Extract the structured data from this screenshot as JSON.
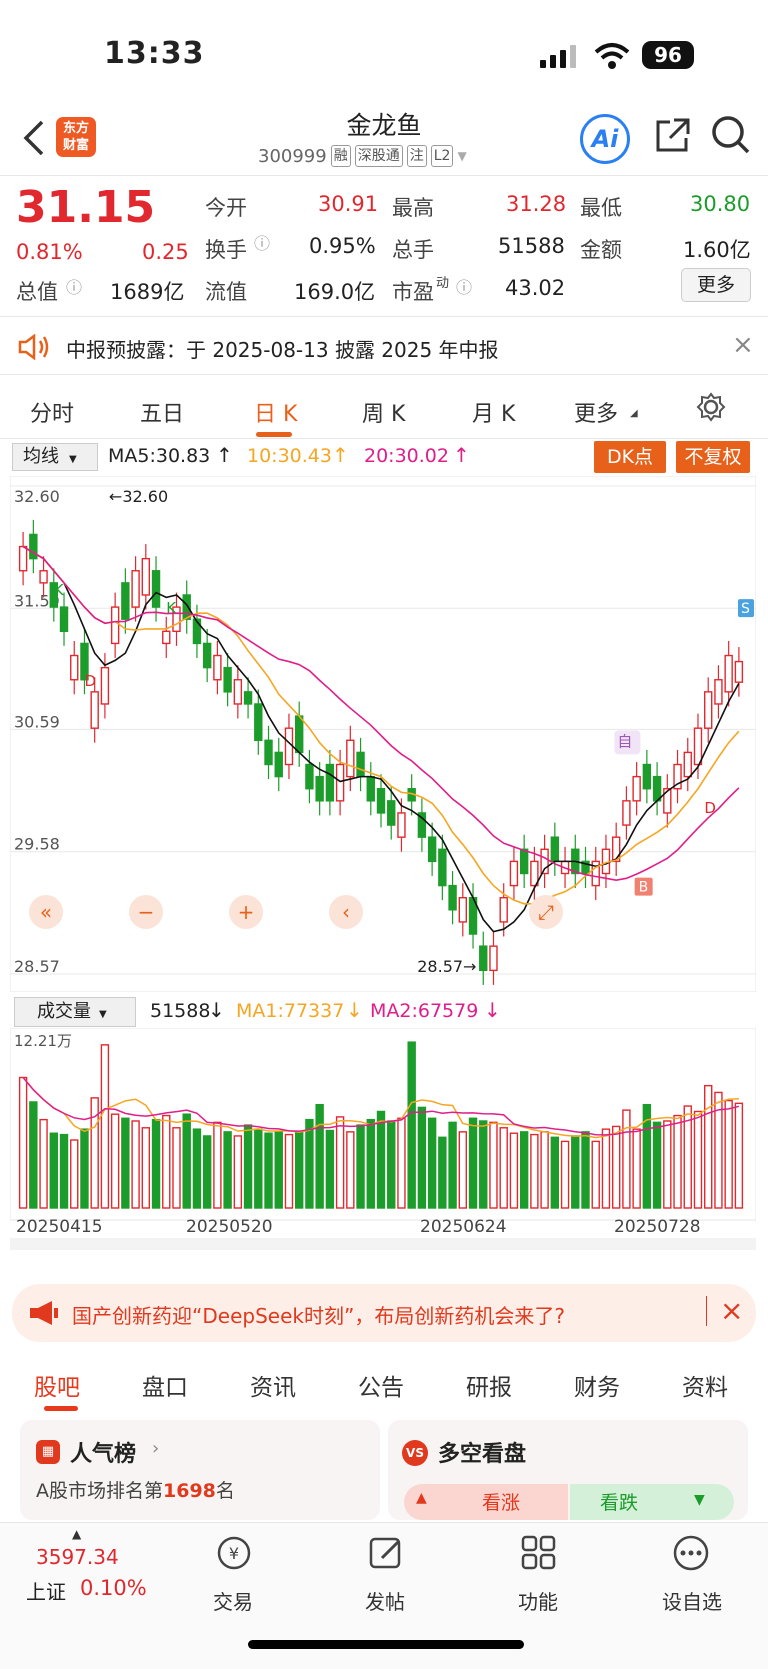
{
  "status": {
    "time": "13:33",
    "battery": "96"
  },
  "header": {
    "title": "金龙鱼",
    "code": "300999",
    "tags": [
      "融",
      "深股通",
      "注",
      "L2"
    ],
    "logo": [
      "东方",
      "财富"
    ],
    "ai_label": "Ai"
  },
  "quote": {
    "price": "31.15",
    "change_pct": "0.81%",
    "change_amt": "0.25",
    "open_label": "今开",
    "open": "30.91",
    "high_label": "最高",
    "high": "31.28",
    "low_label": "最低",
    "low": "30.80",
    "turnover_label": "换手",
    "turnover": "0.95%",
    "volume_label": "总手",
    "volume": "51588",
    "amount_label": "金额",
    "amount": "1.60亿",
    "mktcap_label": "总值",
    "mktcap": "1689亿",
    "float_label": "流值",
    "float": "169.0亿",
    "pe_label": "市盈",
    "pe_sup": "动",
    "pe": "43.02",
    "more_label": "更多"
  },
  "notice": {
    "text": "中报预披露：于 2025-08-13 披露 2025 年中报"
  },
  "chart_tabs": [
    {
      "label": "分时"
    },
    {
      "label": "五日"
    },
    {
      "label": "日 K"
    },
    {
      "label": "周 K"
    },
    {
      "label": "月 K"
    },
    {
      "label": "更多"
    }
  ],
  "ma": {
    "selector": "均线",
    "ma5": "MA5:30.83",
    "ma10": "10:30.43",
    "ma20": "20:30.02",
    "dk_btn": "DK点",
    "fq_btn": "不复权"
  },
  "volume_panel": {
    "selector": "成交量",
    "value": "51588",
    "ma1": "MA1:77337",
    "ma2": "MA2:67579"
  },
  "colors": {
    "up": "#e0282e",
    "down": "#1c9c2a",
    "ma5": "#111111",
    "ma10": "#f5a623",
    "ma20": "#e01e8a",
    "accent": "#e8611a"
  },
  "chart_data": {
    "type": "candlestick",
    "y_ticks": [
      "32.60",
      "31.59",
      "30.59",
      "29.58",
      "28.57"
    ],
    "ylim": [
      28.57,
      32.6
    ],
    "max_label": "32.60",
    "min_label": "28.57",
    "x_labels": [
      "20250415",
      "20250520",
      "20250624",
      "20250728"
    ],
    "vol_max_label": "12.21万",
    "markers": {
      "k": "K",
      "d": "D",
      "s": "S",
      "b": "B",
      "zi": "自"
    },
    "closes": [
      32.1,
      32.0,
      31.9,
      31.6,
      31.4,
      31.2,
      31.0,
      30.9,
      31.1,
      31.6,
      31.5,
      31.9,
      32.0,
      31.6,
      31.4,
      31.6,
      31.5,
      31.3,
      31.1,
      31.2,
      30.9,
      31.0,
      30.8,
      30.5,
      30.3,
      30.2,
      30.6,
      30.4,
      30.1,
      30.0,
      30.0,
      30.3,
      30.5,
      30.2,
      30.0,
      29.9,
      29.8,
      29.9,
      30.0,
      29.7,
      29.5,
      29.3,
      29.1,
      29.2,
      28.9,
      28.6,
      28.8,
      29.2,
      29.5,
      29.4,
      29.5,
      29.6,
      29.5,
      29.5,
      29.4,
      29.4,
      29.5,
      29.6,
      29.7,
      30.0,
      30.2,
      30.1,
      30.0,
      30.1,
      30.3,
      30.4,
      30.6,
      30.9,
      31.0,
      31.2,
      31.15
    ],
    "opens": [
      31.9,
      32.2,
      31.8,
      31.8,
      31.6,
      31.0,
      31.3,
      30.6,
      30.8,
      31.3,
      31.8,
      31.6,
      31.7,
      31.9,
      31.3,
      31.4,
      31.7,
      31.5,
      31.3,
      31.0,
      31.1,
      30.8,
      30.9,
      30.8,
      30.5,
      30.4,
      30.3,
      30.7,
      30.3,
      30.2,
      30.3,
      30.0,
      30.2,
      30.4,
      30.2,
      30.1,
      30.0,
      29.7,
      30.1,
      29.9,
      29.7,
      29.6,
      29.3,
      29.0,
      29.2,
      28.8,
      28.6,
      29.0,
      29.3,
      29.6,
      29.3,
      29.4,
      29.7,
      29.4,
      29.6,
      29.5,
      29.3,
      29.4,
      29.5,
      29.8,
      30.0,
      30.3,
      30.2,
      29.9,
      30.1,
      30.2,
      30.3,
      30.6,
      30.8,
      30.9,
      30.98
    ],
    "volumes": [
      9.6,
      7.8,
      6.5,
      5.5,
      5.4,
      5.0,
      5.8,
      8.1,
      12.0,
      6.9,
      6.6,
      6.4,
      5.9,
      6.5,
      6.8,
      5.9,
      6.9,
      5.8,
      5.3,
      6.3,
      5.6,
      5.3,
      6.1,
      5.8,
      5.5,
      5.6,
      5.4,
      5.6,
      6.5,
      7.6,
      5.7,
      6.7,
      5.6,
      6.1,
      6.5,
      7.1,
      6.4,
      6.6,
      12.2,
      7.4,
      6.6,
      5.2,
      6.3,
      5.6,
      6.6,
      6.4,
      6.3,
      5.9,
      5.5,
      5.6,
      5.4,
      5.6,
      5.2,
      4.9,
      5.3,
      5.6,
      4.9,
      5.8,
      6.0,
      7.2,
      5.8,
      7.6,
      6.3,
      6.4,
      6.8,
      7.5,
      7.1,
      9.0,
      8.5,
      7.9,
      7.7
    ],
    "ma5": "black line, ends 30.83",
    "ma10_last": 30.43,
    "ma20_last": 30.02
  },
  "promo_banner": {
    "text": "国产创新药迎“DeepSeek时刻”，布局创新药机会来了?"
  },
  "bottom_tabs": [
    {
      "label": "股吧"
    },
    {
      "label": "盘口"
    },
    {
      "label": "资讯"
    },
    {
      "label": "公告"
    },
    {
      "label": "研报"
    },
    {
      "label": "财务"
    },
    {
      "label": "资料"
    }
  ],
  "cards": {
    "popularity": {
      "title": "人气榜",
      "rank_prefix": "A股市场排名第",
      "rank": "1698",
      "rank_suffix": "名"
    },
    "bullbear": {
      "title": "多空看盘",
      "bull": "看涨",
      "bear": "看跌"
    }
  },
  "nav": {
    "index_value": "3597.34",
    "index_name": "上证",
    "index_change": "0.10%",
    "items": [
      {
        "label": "交易"
      },
      {
        "label": "发帖"
      },
      {
        "label": "功能"
      },
      {
        "label": "设自选"
      }
    ]
  }
}
